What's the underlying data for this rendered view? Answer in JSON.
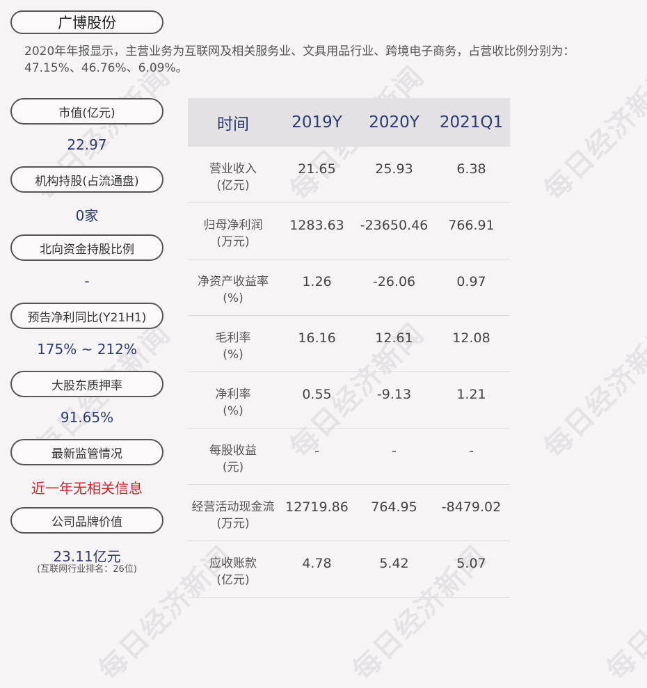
{
  "company": "广博股份",
  "summary": "2020年年报显示，主营业务为互联网及相关服务业、文具用品行业、跨境电子商务，占营收比例分别为：47.15%、46.76%、6.09%。",
  "watermark": "每日经济新闻",
  "left_panel": [
    {
      "label": "市值(亿元)",
      "value": "22.97"
    },
    {
      "label": "机构持股(占流通盘)",
      "value": "0家"
    },
    {
      "label": "北向资金持股比例",
      "value": "-"
    },
    {
      "label": "预告净利同比(Y21H1)",
      "value": "175% ~ 212%"
    },
    {
      "label": "大股东质押率",
      "value": "91.65%"
    },
    {
      "label": "最新监管情况",
      "value": "近一年无相关信息",
      "highlight": "#d2232a"
    },
    {
      "label": "公司品牌价值",
      "value": "23.11亿元",
      "sub": "(互联网行业排名：26位)"
    }
  ],
  "table": {
    "headers": [
      "时间",
      "2019Y",
      "2020Y",
      "2021Q1"
    ],
    "rows": [
      {
        "label": "营业收入",
        "unit": "(亿元)",
        "values": [
          "21.65",
          "25.93",
          "6.38"
        ]
      },
      {
        "label": "归母净利润",
        "unit": "(万元)",
        "values": [
          "1283.63",
          "-23650.46",
          "766.91"
        ]
      },
      {
        "label": "净资产收益率",
        "unit": "(%)",
        "values": [
          "1.26",
          "-26.06",
          "0.97"
        ]
      },
      {
        "label": "毛利率",
        "unit": "(%)",
        "values": [
          "16.16",
          "12.61",
          "12.08"
        ]
      },
      {
        "label": "净利率",
        "unit": "(%)",
        "values": [
          "0.55",
          "-9.13",
          "1.21"
        ]
      },
      {
        "label": "每股收益",
        "unit": "(元)",
        "values": [
          "-",
          "-",
          "-"
        ]
      },
      {
        "label": "经营活动现金流",
        "unit": "(万元)",
        "values": [
          "12719.86",
          "764.95",
          "-8479.02"
        ]
      },
      {
        "label": "应收账款",
        "unit": "(亿元)",
        "values": [
          "4.78",
          "5.42",
          "5.07"
        ]
      }
    ]
  },
  "colors": {
    "accent": "#2d3b6d",
    "alert": "#d2232a",
    "header_bg": "#e3e1e4",
    "page_bg": "#f7f4f6"
  }
}
